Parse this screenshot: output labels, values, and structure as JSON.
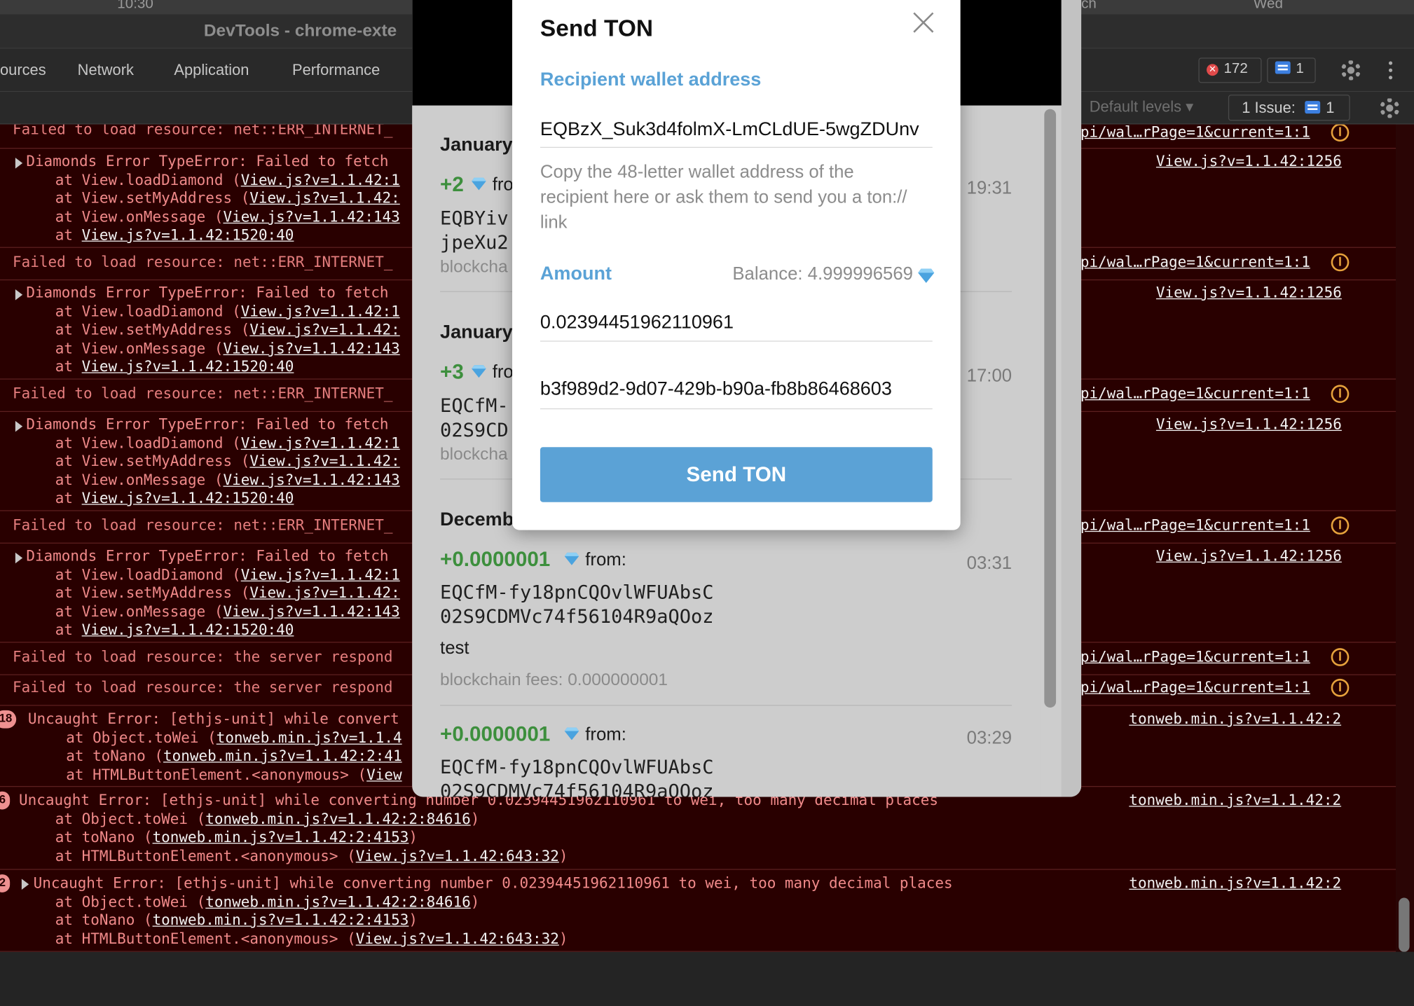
{
  "menubar": {
    "time": "10:30",
    "right_text": "ch",
    "day": "Wed"
  },
  "devtools": {
    "title": "DevTools - chrome-exte",
    "tabs": [
      "ources",
      "Network",
      "Application",
      "Performance"
    ],
    "error_count": "172",
    "message_count": "1",
    "levels_label": "Default levels ▾",
    "issues_label": "1 Issue:",
    "issues_count": "1"
  },
  "console": {
    "fail_internet": "Failed to load resource: net::ERR_INTERNET_",
    "fail_internet_top": "Failed to load resource: net::ERR_INTERNET_",
    "diamonds_error": "Diamonds Error TypeError: Failed to fetch",
    "at_load": "    at View.loadDiamond (",
    "at_load_link": "View.js?v=1.1.42:1",
    "at_set": "    at View.setMyAddress (",
    "at_set_link": "View.js?v=1.1.42:",
    "at_msg": "    at View.onMessage (",
    "at_msg_link": "View.js?v=1.1.42:143",
    "at_anon": "    at ",
    "at_anon_link": "View.js?v=1.1.42:1520:40",
    "src_wal": "pi/wal…rPage=1&current=1:1",
    "src_view": "View.js?v=1.1.42:1256",
    "fail_server": "Failed to load resource: the server respond",
    "tonweb_src": "tonweb.min.js?v=1.1.42:2",
    "g1_count": "18",
    "g1_l1": "Uncaught Error: [ethjs-unit] while convert",
    "g1_l2": "    at Object.toWei (",
    "g1_l2_link": "tonweb.min.js?v=1.1.4",
    "g1_l3": "    at toNano (",
    "g1_l3_link": "tonweb.min.js?v=1.1.42:2:41",
    "g1_l4": "    at HTMLButtonElement.<anonymous> (",
    "g1_l4_link": "View",
    "g2_count": "6",
    "g2_l1": "Uncaught Error: [ethjs-unit] while converting number 0.02394451962110961 to wei, too many decimal places",
    "g2_l2": "    at Object.toWei (",
    "g2_l2_link": "tonweb.min.js?v=1.1.42:2:84616",
    "g2_l2_end": ")",
    "g2_l3": "    at toNano (",
    "g2_l3_link": "tonweb.min.js?v=1.1.42:2:4153",
    "g2_l3_end": ")",
    "g2_l4": "    at HTMLButtonElement.<anonymous> (",
    "g2_l4_link": "View.js?v=1.1.42:643:32",
    "g2_l4_end": ")",
    "g3_count": "2",
    "g3_l1": "Uncaught Error: [ethjs-unit] while converting number 0.02394451962110961 to wei, too many decimal places"
  },
  "wallet": {
    "transactions": [
      {
        "date": "January",
        "amount": "+2",
        "from": "fro",
        "time": "19:31",
        "addr1": "EQBYiv",
        "addr2": "jpeXu2",
        "fee": "blockcha"
      },
      {
        "date": "January",
        "amount": "+3",
        "from": "fro",
        "time": "17:00",
        "addr1": "EQCfM-",
        "addr2": "02S9CD",
        "fee": "blockcha"
      },
      {
        "date": "Decemb",
        "amount": "+0.0000001",
        "from": "from:",
        "time": "03:31",
        "addr1": "EQCfM-fy18pnCQOvlWFUAbsC",
        "addr2": "02S9CDMVc74f56104R9aQOoz",
        "message": "test",
        "fee": "blockchain fees: 0.000000001"
      },
      {
        "date": "",
        "amount": "+0.0000001",
        "from": "from:",
        "time": "03:29",
        "addr1": "EQCfM-fy18pnCQOvlWFUAbsC",
        "addr2": "02S9CDMVc74f56104R9aQOoz"
      }
    ]
  },
  "modal": {
    "title": "Send TON",
    "recipient_label": "Recipient wallet address",
    "recipient_value": "EQBzX_Suk3d4folmX-LmCLdUE-5wgZDUnv",
    "hint": "Copy the 48-letter wallet address of the recipient here or ask them to send you a ton:// link",
    "amount_label": "Amount",
    "balance": "Balance: 4.999996569",
    "amount_value": "0.02394451962110961",
    "comment_value": "b3f989d2-9d07-429b-b90a-fb8b86468603",
    "send_label": "Send TON"
  },
  "colors": {
    "accent": "#5ba2d6",
    "positive": "#3d8f3d",
    "console_error_bg": "#280000",
    "console_error_text": "#f08a8a"
  }
}
